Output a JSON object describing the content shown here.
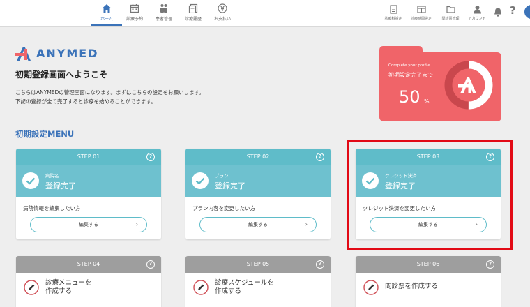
{
  "nav": {
    "items": [
      {
        "label": "ホーム",
        "icon": "home-icon"
      },
      {
        "label": "診療予約",
        "icon": "calendar-icon"
      },
      {
        "label": "患者管理",
        "icon": "patients-icon"
      },
      {
        "label": "診療履歴",
        "icon": "history-icon"
      },
      {
        "label": "お支払い",
        "icon": "yen-icon"
      }
    ],
    "right_items": [
      {
        "label": "診療科設定",
        "icon": "document-icon"
      },
      {
        "label": "診療時間設定",
        "icon": "schedule-icon"
      },
      {
        "label": "問診票管理",
        "icon": "folder-icon"
      },
      {
        "label": "アカウント",
        "icon": "account-icon"
      }
    ],
    "help": "?"
  },
  "header": {
    "logo_text": "ANYMED",
    "welcome": "初期登録画面へようこそ",
    "intro_line1": "こちらはANYMEDの管理画面になります。まずはこちらの設定をお願いします。",
    "intro_line2": "下記の登録が全て完了すると診療を始めることができます。"
  },
  "progress": {
    "small_label": "Complete your profile",
    "title": "初期設定完了まで",
    "percent": 50,
    "percent_text": "50",
    "unit": "%"
  },
  "section_title": "初期設定MENU",
  "steps_done": [
    {
      "step": "STEP 01",
      "sub": "病院名",
      "status": "登録完了",
      "desc": "病院情報を編集したい方",
      "button": "編集する",
      "highlighted": false
    },
    {
      "step": "STEP 02",
      "sub": "プラン",
      "status": "登録完了",
      "desc": "プラン内容を変更したい方",
      "button": "編集する",
      "highlighted": false
    },
    {
      "step": "STEP 03",
      "sub": "クレジット決済",
      "status": "登録完了",
      "desc": "クレジット決済を変更したい方",
      "button": "編集する",
      "highlighted": true
    }
  ],
  "steps_todo": [
    {
      "step": "STEP 04",
      "task_line1": "診療メニューを",
      "task_line2": "作成する"
    },
    {
      "step": "STEP 05",
      "task_line1": "診療スケジュールを",
      "task_line2": "作成する"
    },
    {
      "step": "STEP 06",
      "task_line1": "問診票を作成する",
      "task_line2": ""
    }
  ],
  "colors": {
    "accent_blue": "#3b73b9",
    "teal": "#5fbcc9",
    "coral": "#f06469",
    "gray_header": "#9e9e9e",
    "highlight_red": "#e20a16"
  }
}
